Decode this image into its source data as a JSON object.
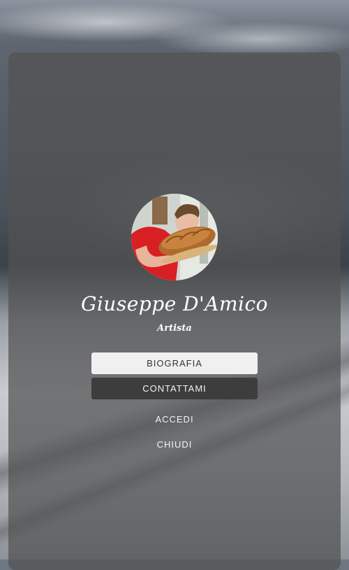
{
  "profile": {
    "name": "Giuseppe D'Amico",
    "role": "Artista",
    "avatar_alt": "profile-photo"
  },
  "actions": {
    "biography_label": "BIOGRAFIA",
    "contact_label": "CONTATTAMI",
    "login_label": "ACCEDI",
    "close_label": "CHIUDI"
  },
  "colors": {
    "card_overlay": "#525252",
    "primary_button_bg": "#f0f0f0",
    "secondary_button_bg": "#3d3d3d",
    "text": "#ffffff"
  }
}
